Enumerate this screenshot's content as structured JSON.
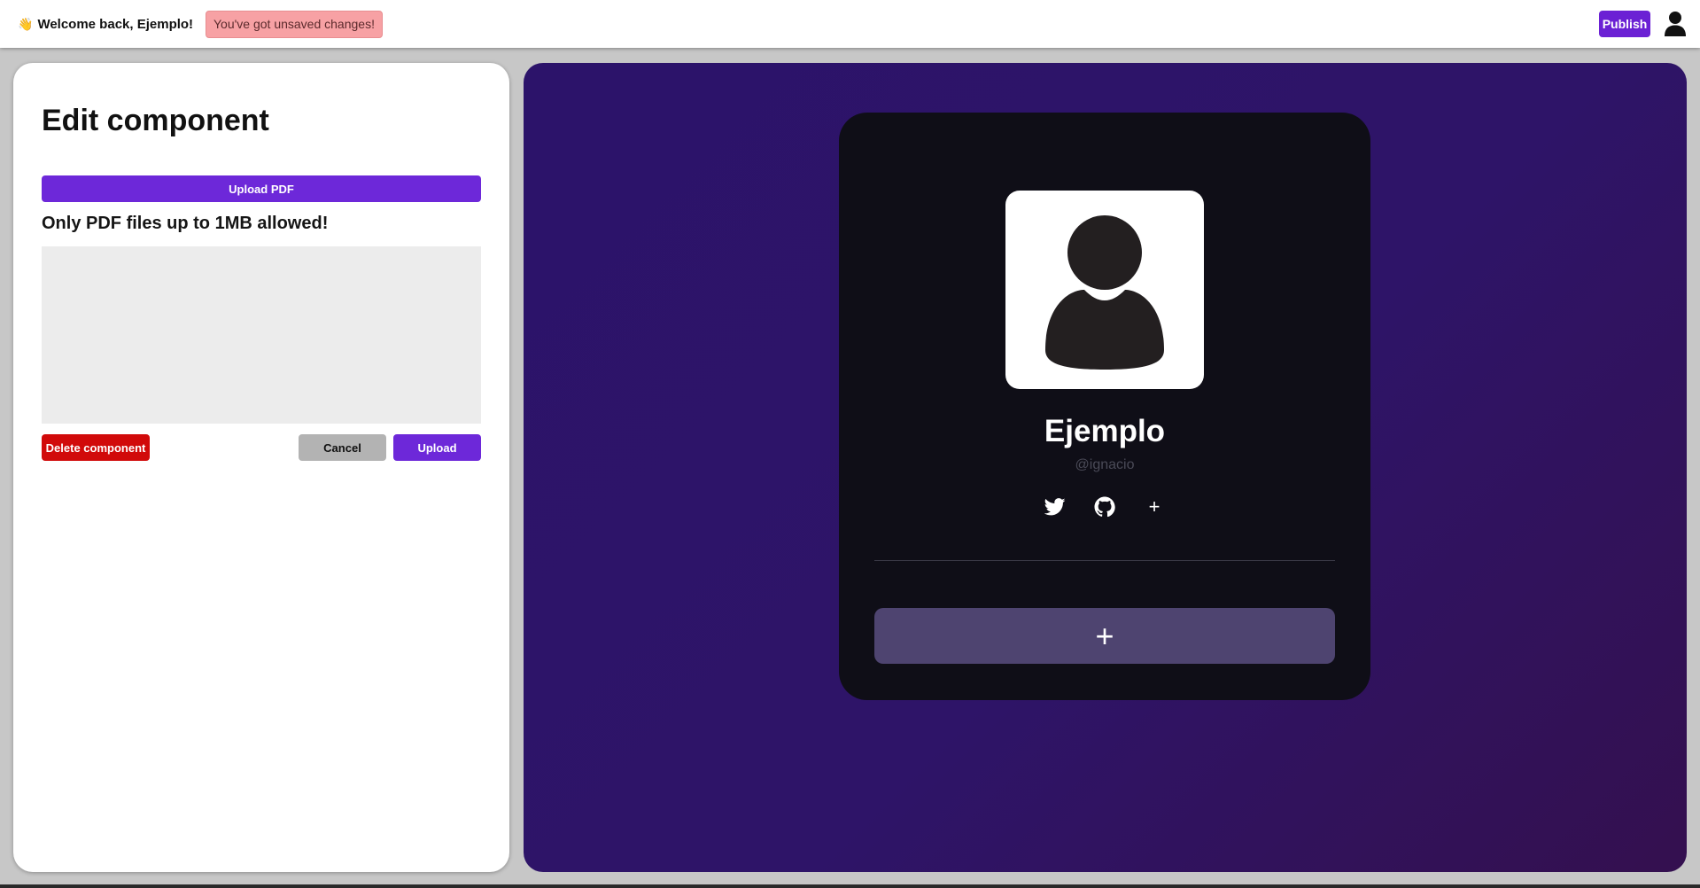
{
  "header": {
    "welcome_emoji": "👋",
    "welcome_text": "Welcome back, Ejemplo!",
    "unsaved_notice": "You've got unsaved changes!",
    "publish_label": "Publish",
    "user_icon": "user-icon"
  },
  "editor": {
    "title": "Edit component",
    "upload_pdf_label": "Upload PDF",
    "note": "Only PDF files up to 1MB allowed!",
    "delete_label": "Delete component",
    "cancel_label": "Cancel",
    "upload_label": "Upload"
  },
  "preview": {
    "name": "Ejemplo",
    "handle": "@ignacio",
    "socials": [
      "twitter-icon",
      "github-icon"
    ],
    "add_social_label": "+",
    "add_block_label": "+"
  },
  "colors": {
    "accent": "#6d28d9",
    "danger": "#d10a0a",
    "notice_bg": "#f7a1a4",
    "preview_bg": "#2c136a",
    "card_bg": "#0f0e17",
    "add_block_bg": "#4e4470"
  }
}
